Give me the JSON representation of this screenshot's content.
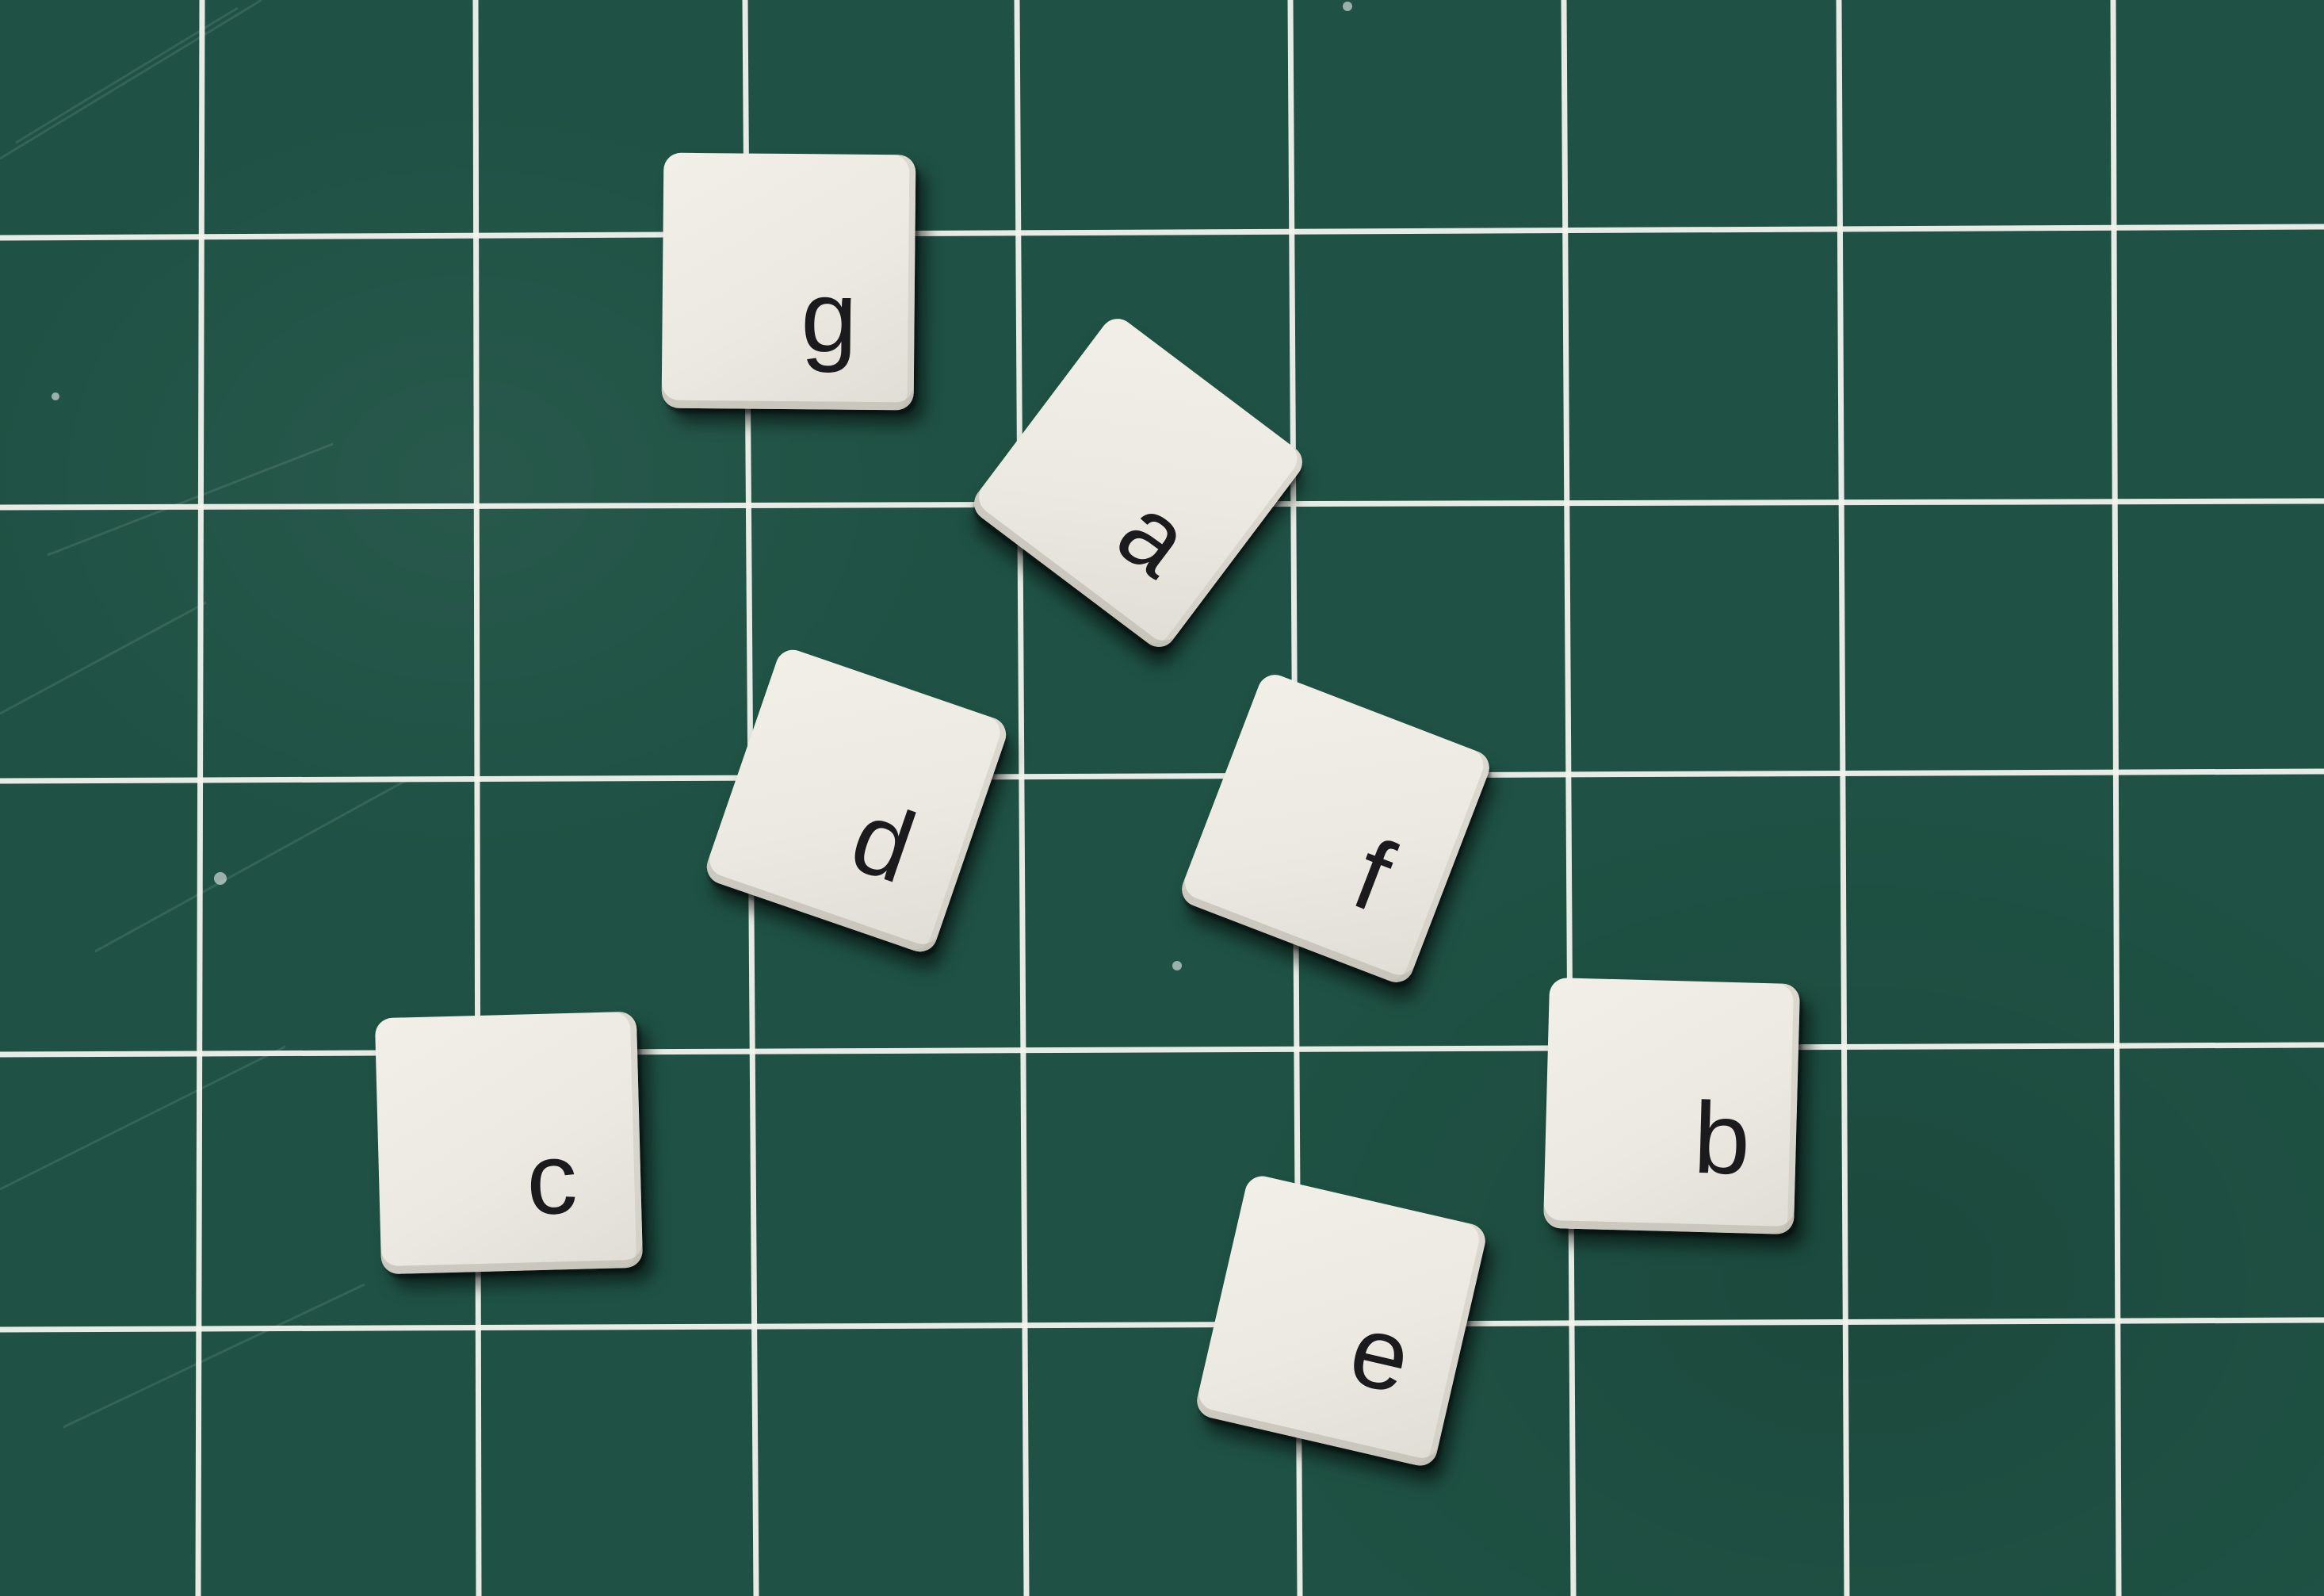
{
  "image": {
    "description_kind": "photo",
    "colors": {
      "mat": "#1f5244",
      "grid_line": "#f3f4ee",
      "tile": "#ece9e2",
      "letter": "#1b1b1d"
    }
  },
  "tiles": [
    {
      "letter": "g"
    },
    {
      "letter": "a"
    },
    {
      "letter": "d"
    },
    {
      "letter": "f"
    },
    {
      "letter": "c"
    },
    {
      "letter": "b"
    },
    {
      "letter": "e"
    }
  ]
}
